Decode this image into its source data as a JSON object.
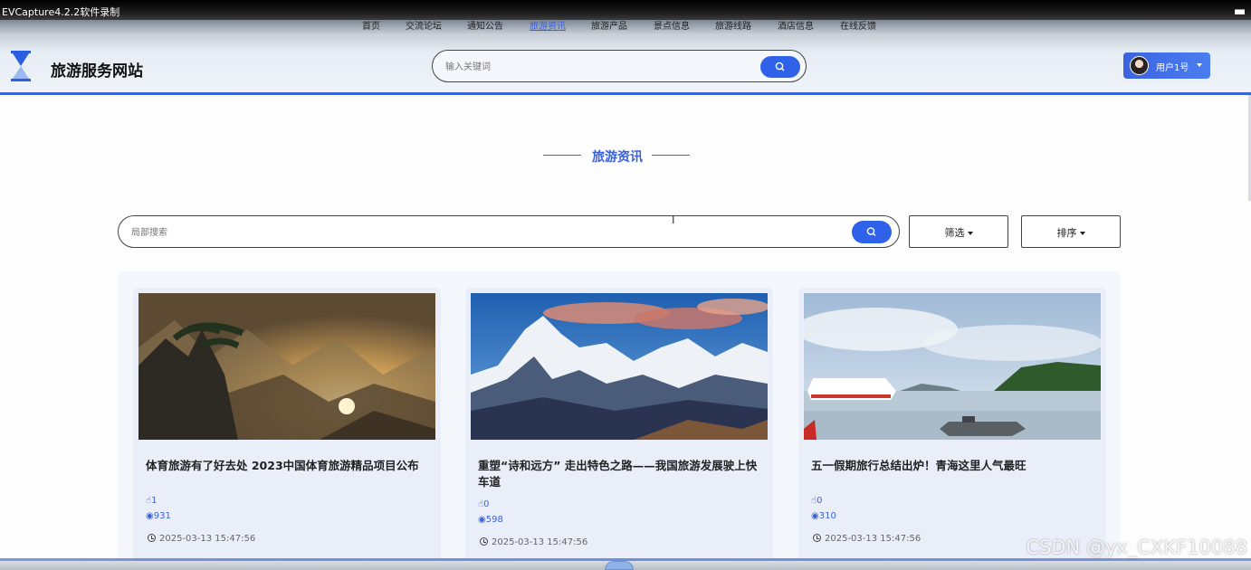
{
  "recorder": {
    "title": "EVCapture4.2.2软件录制"
  },
  "nav": {
    "items": [
      "首页",
      "交流论坛",
      "通知公告",
      "旅游资讯",
      "旅游产品",
      "景点信息",
      "旅游线路",
      "酒店信息",
      "在线反馈"
    ],
    "active": "旅游资讯"
  },
  "header": {
    "site_title": "旅游服务网站",
    "search_placeholder": "输入关键词",
    "user_label": "用户1号"
  },
  "section": {
    "title": "旅游资讯"
  },
  "toolbar": {
    "local_search_placeholder": "局部搜索",
    "filter_label": "筛选",
    "sort_label": "排序"
  },
  "cards": [
    {
      "title": "体育旅游有了好去处 2023中国体育旅游精品项目公布",
      "likes": "1",
      "views": "931",
      "date": "2025-03-13 15:47:56",
      "image": "misty-mountain-pines-sunrise"
    },
    {
      "title": "重塑“诗和远方” 走出特色之路——我国旅游发展驶上快车道",
      "likes": "0",
      "views": "598",
      "date": "2025-03-13 15:47:56",
      "image": "snowy-mountain-peaks-blue-sky"
    },
    {
      "title": "五一假期旅行总结出炉！青海这里人气最旺",
      "likes": "0",
      "views": "310",
      "date": "2025-03-13 15:47:56",
      "image": "lake-ferry-boat-cloudy-sky"
    }
  ],
  "watermark": "CSDN @yx_CXKF10088",
  "colors": {
    "accent": "#2f62e8",
    "title_blue": "#3a62d8",
    "meta_blue": "#3c63d4"
  }
}
